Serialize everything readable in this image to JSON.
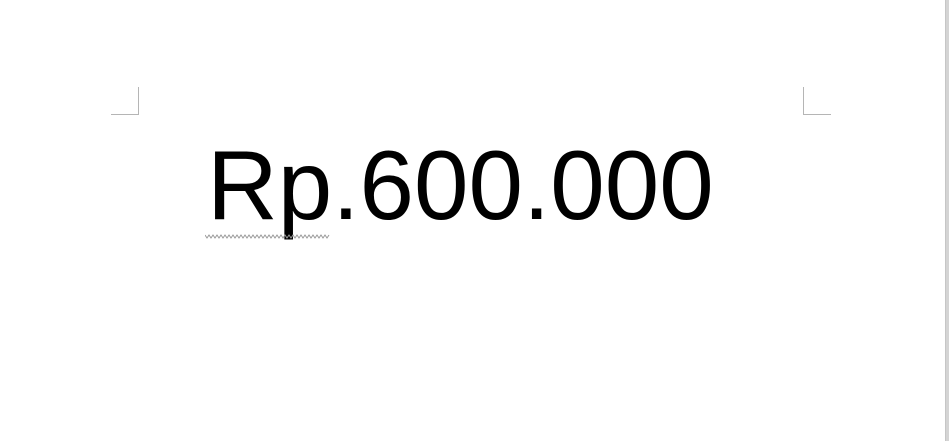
{
  "document": {
    "body_text": "Rp.600.000",
    "spelling_flag_word": "Rp"
  }
}
